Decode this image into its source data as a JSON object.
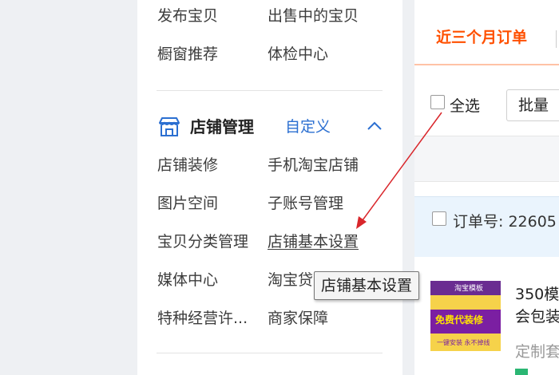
{
  "sidebar": {
    "top_links": [
      "发布宝贝",
      "出售中的宝贝",
      "橱窗推荐",
      "体检中心"
    ],
    "section": {
      "title": "店铺管理",
      "customize_label": "自定义",
      "links": [
        "店铺装修",
        "手机淘宝店铺",
        "图片空间",
        "子账号管理",
        "宝贝分类管理",
        "店铺基本设置",
        "媒体中心",
        "淘宝贷",
        "特种经营许...",
        "商家保障"
      ]
    }
  },
  "main": {
    "tab_label": "近三个月订单",
    "select_all_label": "全选",
    "batch_label": "批量",
    "order_number_label": "订单号: 22605",
    "product": {
      "title_line1": "350模",
      "title_line2": "会包装",
      "subtitle": "定制套",
      "thumb_top": "淘宝模板",
      "thumb_main": "免费代装修",
      "thumb_bottom": "一键安装 永不掉线"
    }
  },
  "tooltip": {
    "text": "店铺基本设置"
  },
  "colors": {
    "accent": "#ff5000",
    "link_blue": "#2b6fd1",
    "annotation_arrow": "#d9262b"
  },
  "icons": {
    "shop": "shop-icon",
    "collapse": "chevron-up-icon"
  }
}
